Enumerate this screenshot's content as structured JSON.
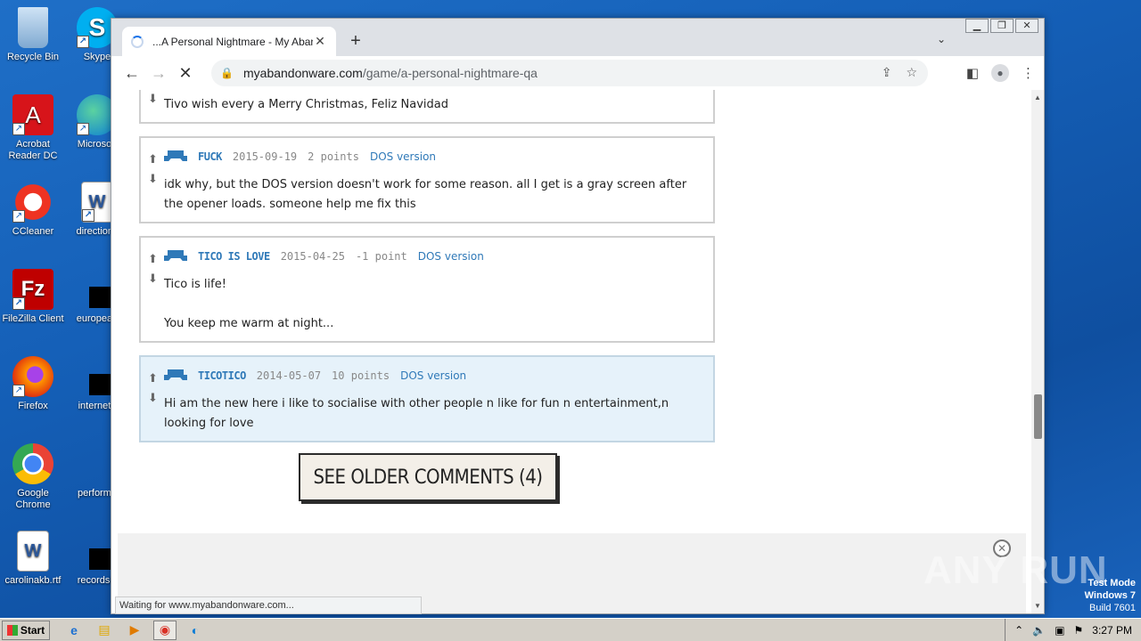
{
  "desktop": {
    "icons": [
      {
        "label": "Recycle Bin",
        "icon": "recycle-bin-icon"
      },
      {
        "label": "Skype",
        "icon": "skype-icon"
      },
      {
        "label": "Acrobat Reader DC",
        "icon": "acrobat-icon"
      },
      {
        "label": "Microsoft",
        "icon": "edge-icon"
      },
      {
        "label": "CCleaner",
        "icon": "ccleaner-icon"
      },
      {
        "label": "directions",
        "icon": "word-doc-icon"
      },
      {
        "label": "FileZilla Client",
        "icon": "filezilla-icon"
      },
      {
        "label": "european",
        "icon": "file-icon"
      },
      {
        "label": "Firefox",
        "icon": "firefox-icon"
      },
      {
        "label": "internetp",
        "icon": "file-icon"
      },
      {
        "label": "Google Chrome",
        "icon": "chrome-icon"
      },
      {
        "label": "performa",
        "icon": "file-icon"
      },
      {
        "label": "carolinakb.rtf",
        "icon": "word-doc-icon"
      },
      {
        "label": "recordsly",
        "icon": "file-icon"
      }
    ]
  },
  "browser": {
    "tab": {
      "title": "...A Personal Nightmare - My Aband"
    },
    "url_host": "myabandonware.com",
    "url_path": "/game/a-personal-nightmare-qa",
    "status": "Waiting for www.myabandonware.com..."
  },
  "comments": [
    {
      "username": "",
      "date": "",
      "points": "",
      "version": "",
      "body": [
        "Tivo wish every a Merry Christmas, Feliz Navidad"
      ]
    },
    {
      "username": "FUCK",
      "date": "2015-09-19",
      "points": "2 points",
      "version": "DOS version",
      "body": [
        "idk why, but the DOS version doesn't work for some reason. all I get is a gray screen after the opener loads. someone help me fix this"
      ]
    },
    {
      "username": "TICO IS LOVE",
      "date": "2015-04-25",
      "points": "-1 point",
      "version": "DOS version",
      "body": [
        "Tico is life!",
        "You keep me warm at night..."
      ]
    },
    {
      "username": "TICOTICO",
      "date": "2014-05-07",
      "points": "10 points",
      "version": "DOS version",
      "body": [
        "Hi am the new here i like to socialise with other people n like for fun n entertainment,n looking for love"
      ]
    }
  ],
  "older_button": "SEE OLDER COMMENTS (4)",
  "watermark": {
    "text": "ANY RUN"
  },
  "testmode": {
    "line1": "Test Mode",
    "line2": "Windows 7",
    "line3": "Build 7601"
  },
  "taskbar": {
    "start_label": "Start",
    "clock": "3:27 PM"
  }
}
